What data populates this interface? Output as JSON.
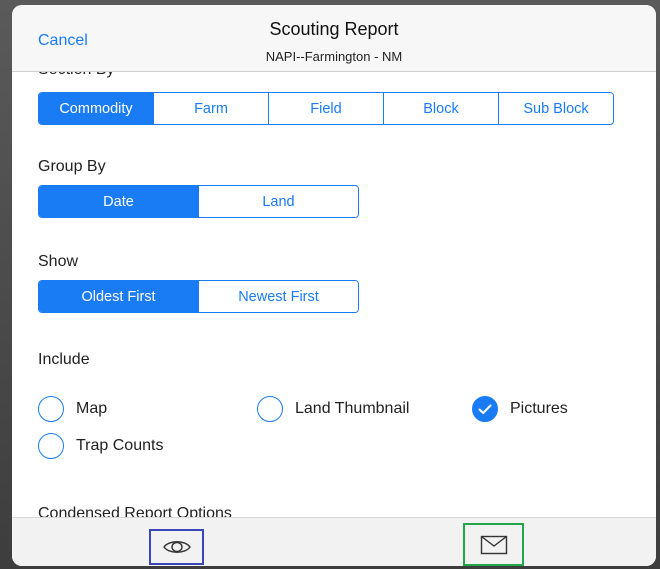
{
  "header": {
    "cancel_label": "Cancel",
    "title": "Scouting Report",
    "subtitle": "NAPI--Farmington - NM"
  },
  "section_by": {
    "label": "Section By",
    "options": [
      "Commodity",
      "Farm",
      "Field",
      "Block",
      "Sub Block"
    ],
    "selected": "Commodity"
  },
  "group_by": {
    "label": "Group By",
    "options": [
      "Date",
      "Land"
    ],
    "selected": "Date"
  },
  "show": {
    "label": "Show",
    "options": [
      "Oldest First",
      "Newest First"
    ],
    "selected": "Oldest First"
  },
  "include": {
    "label": "Include",
    "items": [
      {
        "label": "Map",
        "checked": false
      },
      {
        "label": "Land Thumbnail",
        "checked": false
      },
      {
        "label": "Pictures",
        "checked": true
      },
      {
        "label": "Trap Counts",
        "checked": false
      }
    ]
  },
  "condensed": {
    "label": "Condensed Report Options"
  },
  "toolbar": {
    "preview_icon": "eye-icon",
    "email_icon": "mail-icon"
  },
  "colors": {
    "accent": "#1a7cf5",
    "preview_highlight": "#3846b8",
    "email_highlight": "#21a64a"
  }
}
